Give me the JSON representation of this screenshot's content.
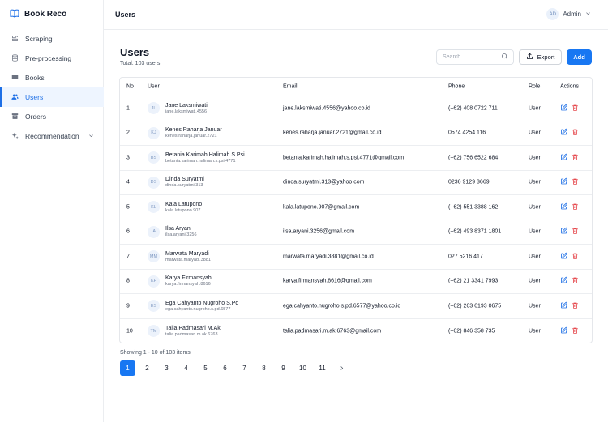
{
  "brand": {
    "name": "Book Reco"
  },
  "sidebar": {
    "items": [
      {
        "label": "Scraping",
        "icon": "scraping-icon"
      },
      {
        "label": "Pre-processing",
        "icon": "database-icon"
      },
      {
        "label": "Books",
        "icon": "book-icon"
      },
      {
        "label": "Users",
        "icon": "users-icon",
        "active": true
      },
      {
        "label": "Orders",
        "icon": "archive-icon"
      },
      {
        "label": "Recommendation",
        "icon": "sparkle-icon"
      }
    ]
  },
  "topbar": {
    "title": "Users",
    "user_initials": "AD",
    "user_name": "Admin"
  },
  "page": {
    "title": "Users",
    "subtitle": "Total: 103 users",
    "search_placeholder": "Search...",
    "export_label": "Export",
    "add_label": "Add"
  },
  "table": {
    "headers": {
      "no": "No",
      "user": "User",
      "email": "Email",
      "phone": "Phone",
      "role": "Role",
      "actions": "Actions"
    },
    "rows": [
      {
        "no": "1",
        "initials": "JL",
        "name": "Jane Laksmiwati",
        "handle": "jane.laksmiwati.4556",
        "email": "jane.laksmiwati.4556@yahoo.co.id",
        "phone": "(+62) 408 0722 711",
        "role": "User"
      },
      {
        "no": "2",
        "initials": "KJ",
        "name": "Kenes Raharja Januar",
        "handle": "kenes.raharja.januar.2721",
        "email": "kenes.raharja.januar.2721@gmail.co.id",
        "phone": "0574 4254 116",
        "role": "User"
      },
      {
        "no": "3",
        "initials": "BS",
        "name": "Betania Karimah Halimah S.Psi",
        "handle": "betania.karimah.halimah.s.psi.4771",
        "email": "betania.karimah.halimah.s.psi.4771@gmail.com",
        "phone": "(+62) 756 6522 684",
        "role": "User"
      },
      {
        "no": "4",
        "initials": "DS",
        "name": "Dinda Suryatmi",
        "handle": "dinda.suryatmi.313",
        "email": "dinda.suryatmi.313@yahoo.com",
        "phone": "0236 9129 3669",
        "role": "User"
      },
      {
        "no": "5",
        "initials": "KL",
        "name": "Kala Latupono",
        "handle": "kala.latupono.907",
        "email": "kala.latupono.907@gmail.com",
        "phone": "(+62) 551 3388 162",
        "role": "User"
      },
      {
        "no": "6",
        "initials": "IA",
        "name": "Ilsa Aryani",
        "handle": "ilsa.aryani.3256",
        "email": "ilsa.aryani.3256@gmail.com",
        "phone": "(+62) 493 8371 1801",
        "role": "User"
      },
      {
        "no": "7",
        "initials": "MM",
        "name": "Marwata Maryadi",
        "handle": "marwata.maryadi.3881",
        "email": "marwata.maryadi.3881@gmail.co.id",
        "phone": "027 5216 417",
        "role": "User"
      },
      {
        "no": "8",
        "initials": "KF",
        "name": "Karya Firmansyah",
        "handle": "karya.firmansyah.8616",
        "email": "karya.firmansyah.8616@gmail.com",
        "phone": "(+62) 21 3341 7993",
        "role": "User"
      },
      {
        "no": "9",
        "initials": "ES",
        "name": "Ega Cahyanto Nugroho S.Pd",
        "handle": "ega.cahyanto.nugroho.s.pd.6577",
        "email": "ega.cahyanto.nugroho.s.pd.6577@yahoo.co.id",
        "phone": "(+62) 263 6193 0675",
        "role": "User"
      },
      {
        "no": "10",
        "initials": "TM",
        "name": "Talia Padmasari M.Ak",
        "handle": "talia.padmasari.m.ak.6763",
        "email": "talia.padmasari.m.ak.6763@gmail.com",
        "phone": "(+62) 846 358 735",
        "role": "User"
      }
    ]
  },
  "pagination": {
    "showing": "Showing 1 - 10 of 103 items",
    "pages": [
      "1",
      "2",
      "3",
      "4",
      "5",
      "6",
      "7",
      "8",
      "9",
      "10",
      "11"
    ],
    "current": "1"
  },
  "colors": {
    "accent": "#1877f2",
    "danger": "#e5484d",
    "edit": "#1d6fe6"
  }
}
